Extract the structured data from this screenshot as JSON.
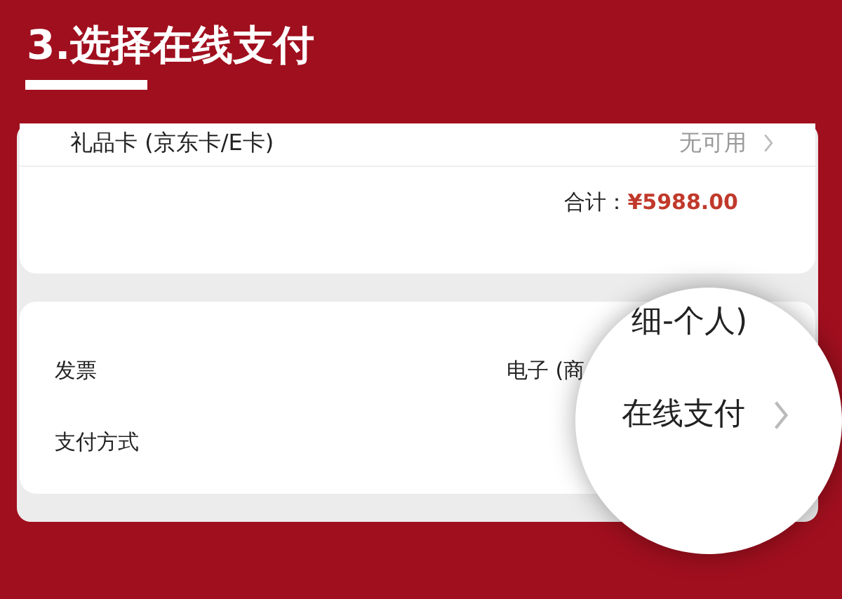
{
  "title": "3.选择在线支付",
  "order_rows": [
    {
      "label": "礼品卡 (京东卡/E卡)",
      "value": "无可用"
    }
  ],
  "total": {
    "label": "合计：",
    "amount": "¥5988.00"
  },
  "detail_rows": [
    {
      "label": "发票",
      "value": "电子 (商"
    },
    {
      "label": "支付方式"
    }
  ],
  "magnifier": {
    "lines": [
      {
        "text": "细-个人)",
        "chevron": false
      },
      {
        "text": "在线支付",
        "chevron": true
      }
    ]
  }
}
